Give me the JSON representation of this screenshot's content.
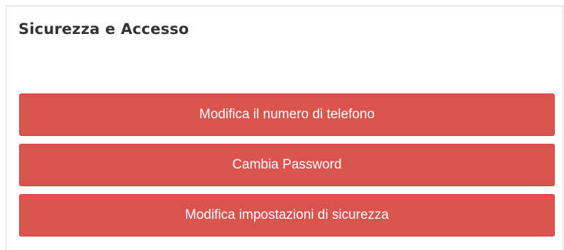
{
  "panel": {
    "title": "Sicurezza e Accesso",
    "buttons": [
      {
        "label": "Modifica il numero di telefono"
      },
      {
        "label": "Cambia Password"
      },
      {
        "label": "Modifica impostazioni di sicurezza"
      }
    ]
  },
  "colors": {
    "button_bg": "#d9534f",
    "button_border": "#d43f3a",
    "button_text": "#ffffff",
    "title_text": "#333333"
  }
}
